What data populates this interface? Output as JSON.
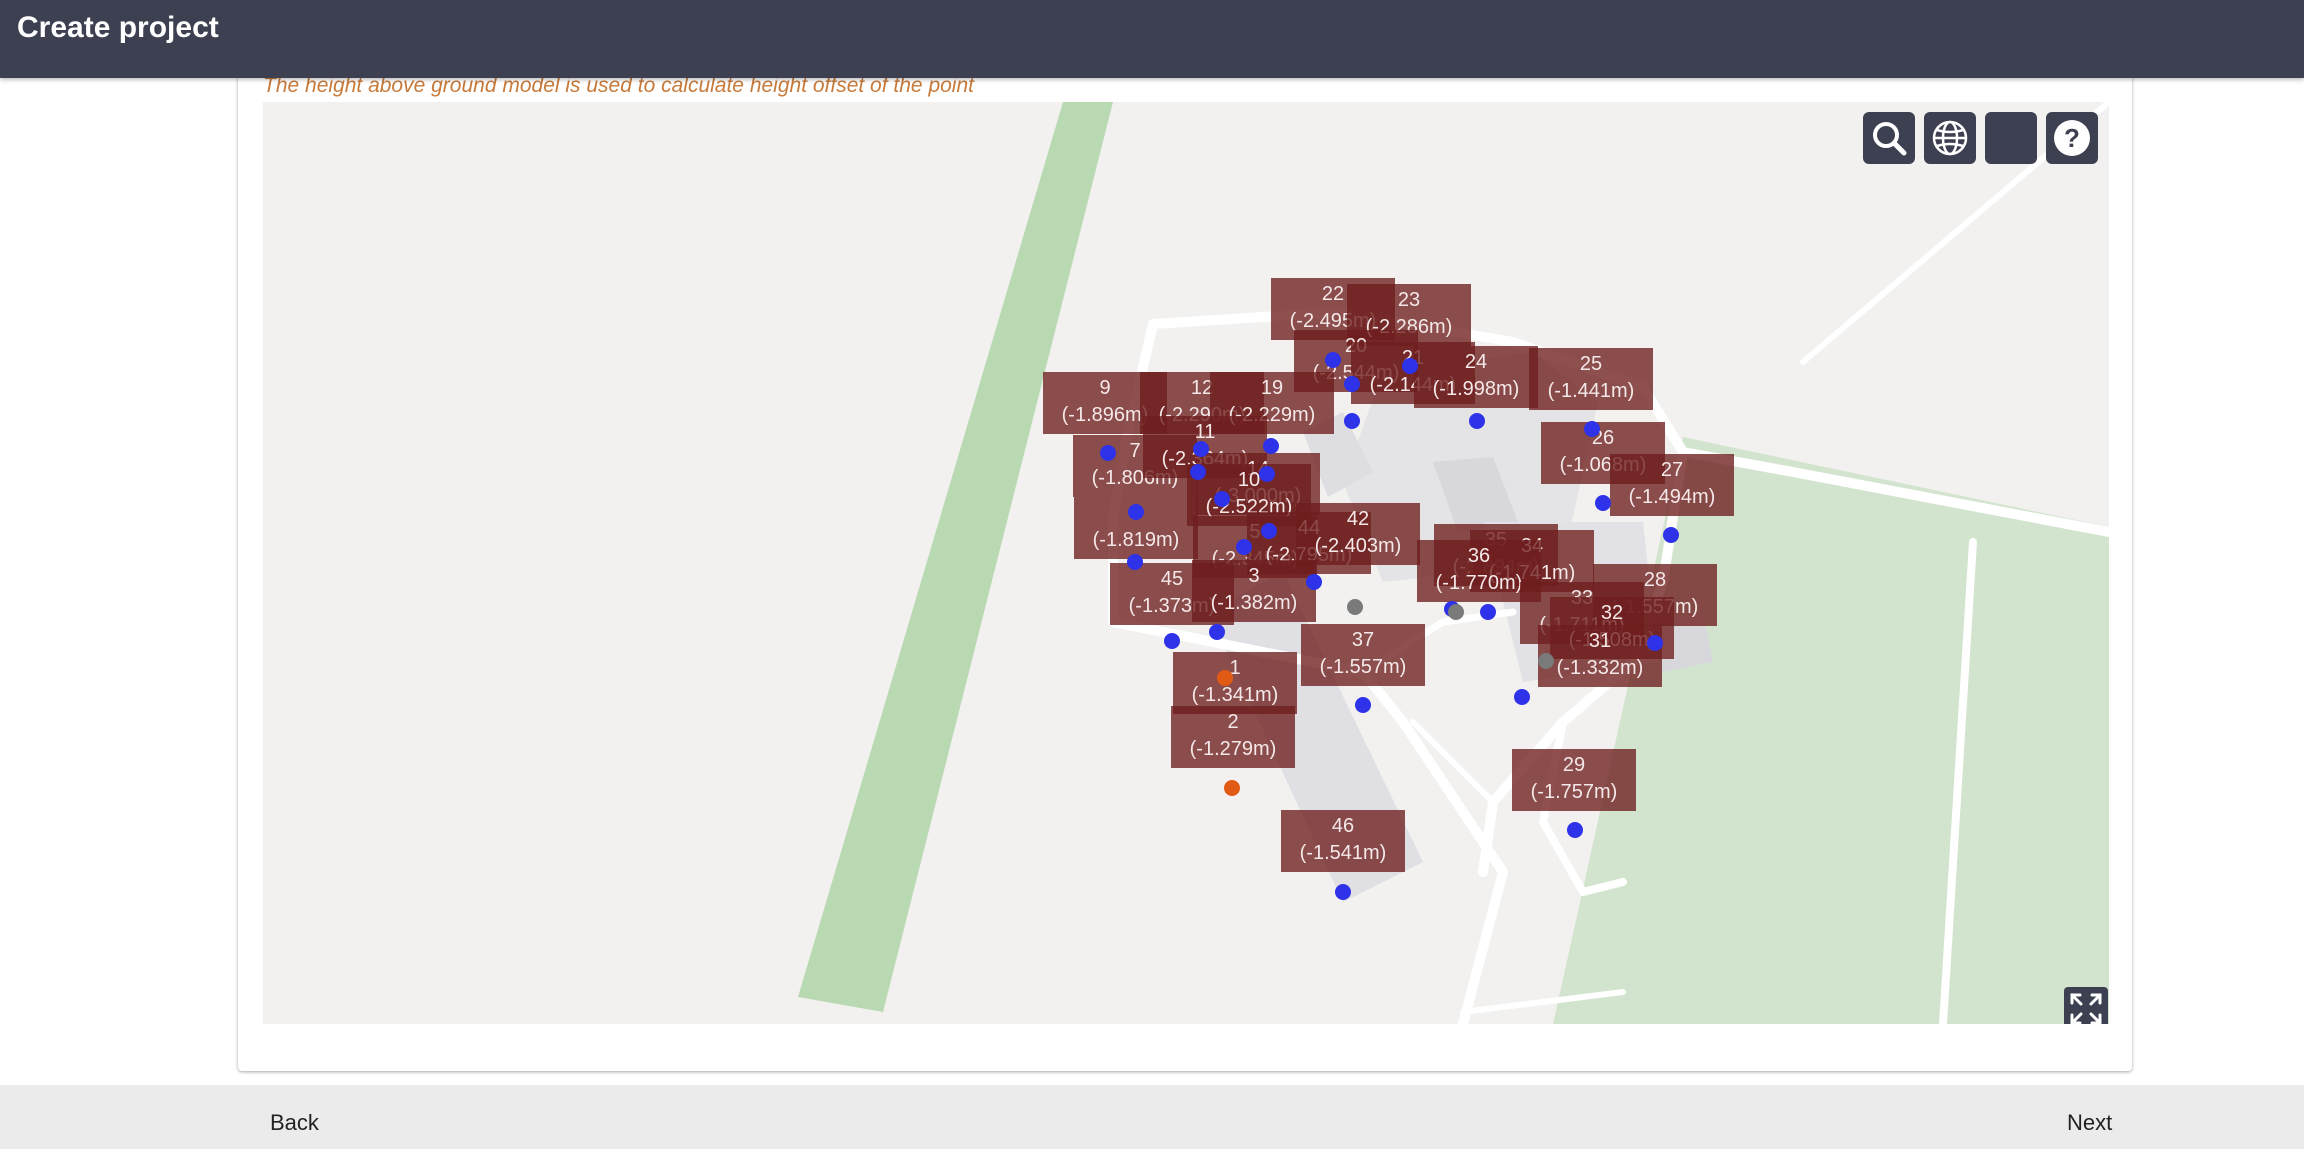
{
  "header": {
    "title": "Create project"
  },
  "hint": "The height above ground model is used to calculate height offset of the point",
  "map": {
    "controls": [
      {
        "name": "search-map-button",
        "icon": "search-icon"
      },
      {
        "name": "globe-layer-button",
        "icon": "globe-icon"
      },
      {
        "name": "blank-map-button",
        "icon": "blank-square-icon"
      },
      {
        "name": "help-map-button",
        "icon": "question-icon"
      }
    ],
    "fullscreen_icon": "fullscreen-icon",
    "colors": {
      "point": "#2e32e8",
      "point_selected": "#e15a14",
      "point_inactive": "#7a7a7a",
      "label_bg": "#6e1e1e",
      "park": "#b9d9b3"
    },
    "points": [
      {
        "id": "22",
        "height": "(-2.495m)"
      },
      {
        "id": "23",
        "height": "(-2.286m)"
      },
      {
        "id": "20",
        "height": "(-2.544m)"
      },
      {
        "id": "21",
        "height": "(-2.144m)"
      },
      {
        "id": "24",
        "height": "(-1.998m)"
      },
      {
        "id": "25",
        "height": "(-1.441m)"
      },
      {
        "id": "9",
        "height": "(-1.896m)"
      },
      {
        "id": "12",
        "height": "(-2.290m)"
      },
      {
        "id": "19",
        "height": "(-2.229m)"
      },
      {
        "id": "26",
        "height": "(-1.068m)"
      },
      {
        "id": "7",
        "height": "(-1.806m)"
      },
      {
        "id": "11",
        "height": "(-2.364m)"
      },
      {
        "id": "14",
        "height": "(-3.000m)"
      },
      {
        "id": "27",
        "height": "(-1.494m)"
      },
      {
        "id": "10",
        "height": "(-2.522m)"
      },
      {
        "id": "6",
        "height": "(-1.819m)"
      },
      {
        "id": "5",
        "height": "(-2.345m)"
      },
      {
        "id": "44",
        "height": "(-2.795m)"
      },
      {
        "id": "42",
        "height": "(-2.403m)"
      },
      {
        "id": "35",
        "height": "(-1.894m)"
      },
      {
        "id": "34",
        "height": "(-1.741m)"
      },
      {
        "id": "36",
        "height": "(-1.770m)"
      },
      {
        "id": "45",
        "height": "(-1.373m)"
      },
      {
        "id": "3",
        "height": "(-1.382m)"
      },
      {
        "id": "28",
        "height": "(-1.557m)"
      },
      {
        "id": "33",
        "height": "(-1.711m)"
      },
      {
        "id": "32",
        "height": "(-1.508m)"
      },
      {
        "id": "31",
        "height": "(-1.332m)"
      },
      {
        "id": "37",
        "height": "(-1.557m)"
      },
      {
        "id": "1",
        "height": "(-1.341m)"
      },
      {
        "id": "2",
        "height": "(-1.279m)"
      },
      {
        "id": "29",
        "height": "(-1.757m)"
      },
      {
        "id": "46",
        "height": "(-1.541m)"
      }
    ]
  },
  "footer": {
    "back_label": "Back",
    "next_label": "Next"
  }
}
